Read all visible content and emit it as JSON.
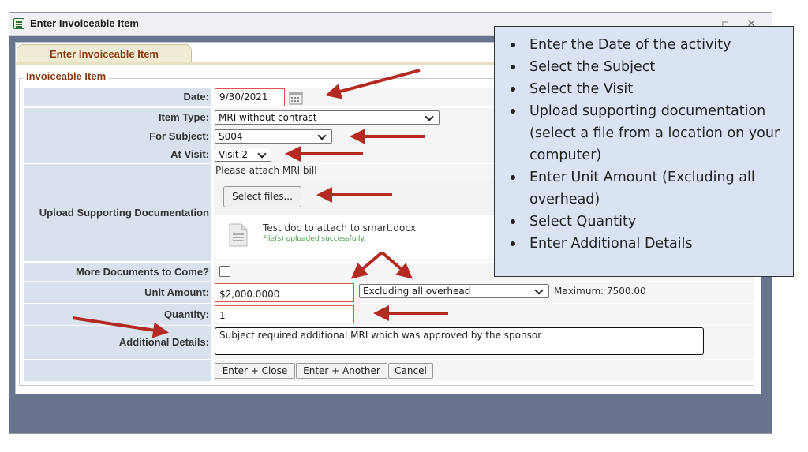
{
  "window": {
    "title": "Enter Invoiceable Item",
    "min_glyph": "▫",
    "close_glyph": "✕"
  },
  "tab": {
    "label": "Enter Invoiceable Item"
  },
  "form": {
    "legend": "Invoiceable Item",
    "date": {
      "label": "Date:",
      "value": "9/30/2021"
    },
    "item_type": {
      "label": "Item Type:",
      "value": "MRI without contrast"
    },
    "subject": {
      "label": "For Subject:",
      "value": "S004"
    },
    "visit": {
      "label": "At Visit:",
      "value": "Visit 2"
    },
    "upload": {
      "label": "Upload Supporting Documentation",
      "hint": "Please attach MRI bill",
      "select_button": "Select files...",
      "file_name": "Test doc to attach to smart.docx",
      "file_status": "File(s) uploaded successfully."
    },
    "more_docs": {
      "label": "More Documents to Come?"
    },
    "unit_amount": {
      "label": "Unit Amount:",
      "value": "$2,000.0000",
      "overhead": "Excluding all overhead",
      "maximum": "Maximum: 7500.00"
    },
    "quantity": {
      "label": "Quantity:",
      "value": "1"
    },
    "details": {
      "label": "Additional Details:",
      "value": "Subject required additional MRI which was approved by the sponsor"
    },
    "buttons": {
      "enter_close": "Enter + Close",
      "enter_another": "Enter + Another",
      "cancel": "Cancel"
    }
  },
  "instructions": [
    "Enter the Date of the activity",
    "Select the Subject",
    "Select the Visit",
    "Upload supporting documentation (select a file from a location on your computer)",
    "Enter Unit Amount (Excluding all overhead)",
    "Select Quantity",
    "Enter Additional Details"
  ],
  "icons": {
    "title": "form-icon",
    "calendar": "calendar-icon",
    "file": "document-icon",
    "arrow": "red-arrow-icon"
  },
  "colors": {
    "arrow": "#b22a22",
    "label_bg": "#d9e1ec",
    "legend": "#8a3a10",
    "window_bg": "#69758f",
    "note_bg": "#dae3f3"
  }
}
